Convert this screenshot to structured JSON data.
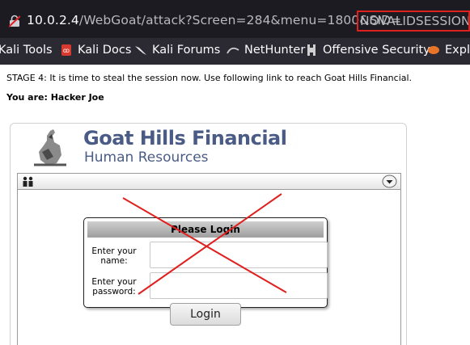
{
  "browser": {
    "url_host": "10.0.2.4",
    "url_path": "/WebGoat/attack?Screen=284&menu=1800&SID=",
    "url_highlight": "NOVALIDSESSION"
  },
  "bookmarks": [
    {
      "label": "Kali Tools"
    },
    {
      "label": "Kali Docs"
    },
    {
      "label": "Kali Forums"
    },
    {
      "label": "NetHunter"
    },
    {
      "label": "Offensive Security"
    },
    {
      "label": "Explo"
    }
  ],
  "page": {
    "stage_text": "STAGE 4: It is time to steal the session now. Use following link to reach Goat Hills Financial.",
    "you_are": "You are: Hacker Joe"
  },
  "app": {
    "brand_title": "Goat Hills Financial",
    "brand_subtitle": "Human Resources"
  },
  "login": {
    "heading": "Please Login",
    "name_label_line1": "Enter your",
    "name_label_line2": "name:",
    "password_label_line1": "Enter your",
    "password_label_line2": "password:",
    "name_value": "",
    "password_value": "",
    "button_label": "Login"
  },
  "colors": {
    "url_highlight_border": "#e0201f",
    "brand": "#4a5c86",
    "cross": "#e0201f"
  }
}
